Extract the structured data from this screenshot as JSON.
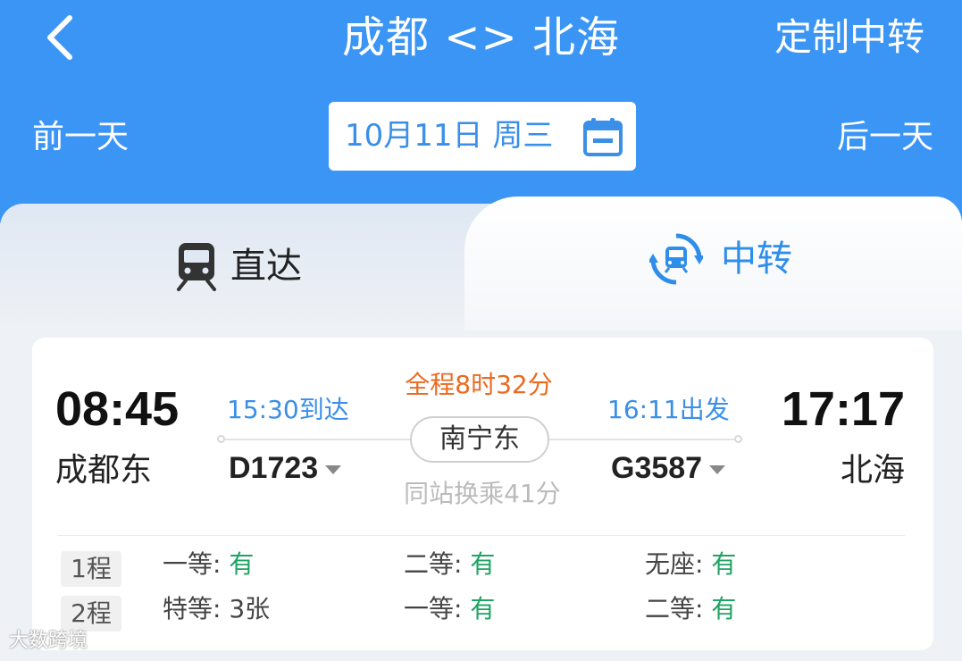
{
  "header": {
    "title": "成都 <> 北海",
    "custom_transfer": "定制中转",
    "prev_day": "前一天",
    "next_day": "后一天",
    "date": "10月11日 周三"
  },
  "tabs": [
    {
      "label": "直达",
      "icon": "train-icon",
      "selected": false
    },
    {
      "label": "中转",
      "icon": "transfer-icon",
      "selected": true
    }
  ],
  "result": {
    "departure_time": "08:45",
    "departure_station": "成都东",
    "arrival_time": "17:17",
    "arrival_station": "北海",
    "leg1_arrive": "15:30到达",
    "leg2_depart": "16:11出发",
    "total_duration": "全程8时32分",
    "transfer_station": "南宁东",
    "leg1_train": "D1723",
    "leg2_train": "G3587",
    "transfer_note": "同站换乘41分",
    "legs": [
      {
        "tag": "1程",
        "seats": [
          {
            "class": "一等:",
            "availability": "有"
          },
          {
            "class": "二等:",
            "availability": "有"
          },
          {
            "class": "无座:",
            "availability": "有"
          }
        ]
      },
      {
        "tag": "2程",
        "seats": [
          {
            "class": "特等:",
            "availability": "3张"
          },
          {
            "class": "一等:",
            "availability": "有"
          },
          {
            "class": "二等:",
            "availability": "有"
          }
        ]
      }
    ]
  },
  "colors": {
    "header_bg": "#3a95f5",
    "accent_blue": "#3a8fe8",
    "duration_orange": "#ec6a1e",
    "available_green": "#1fa364"
  },
  "watermark": "大数跨境"
}
